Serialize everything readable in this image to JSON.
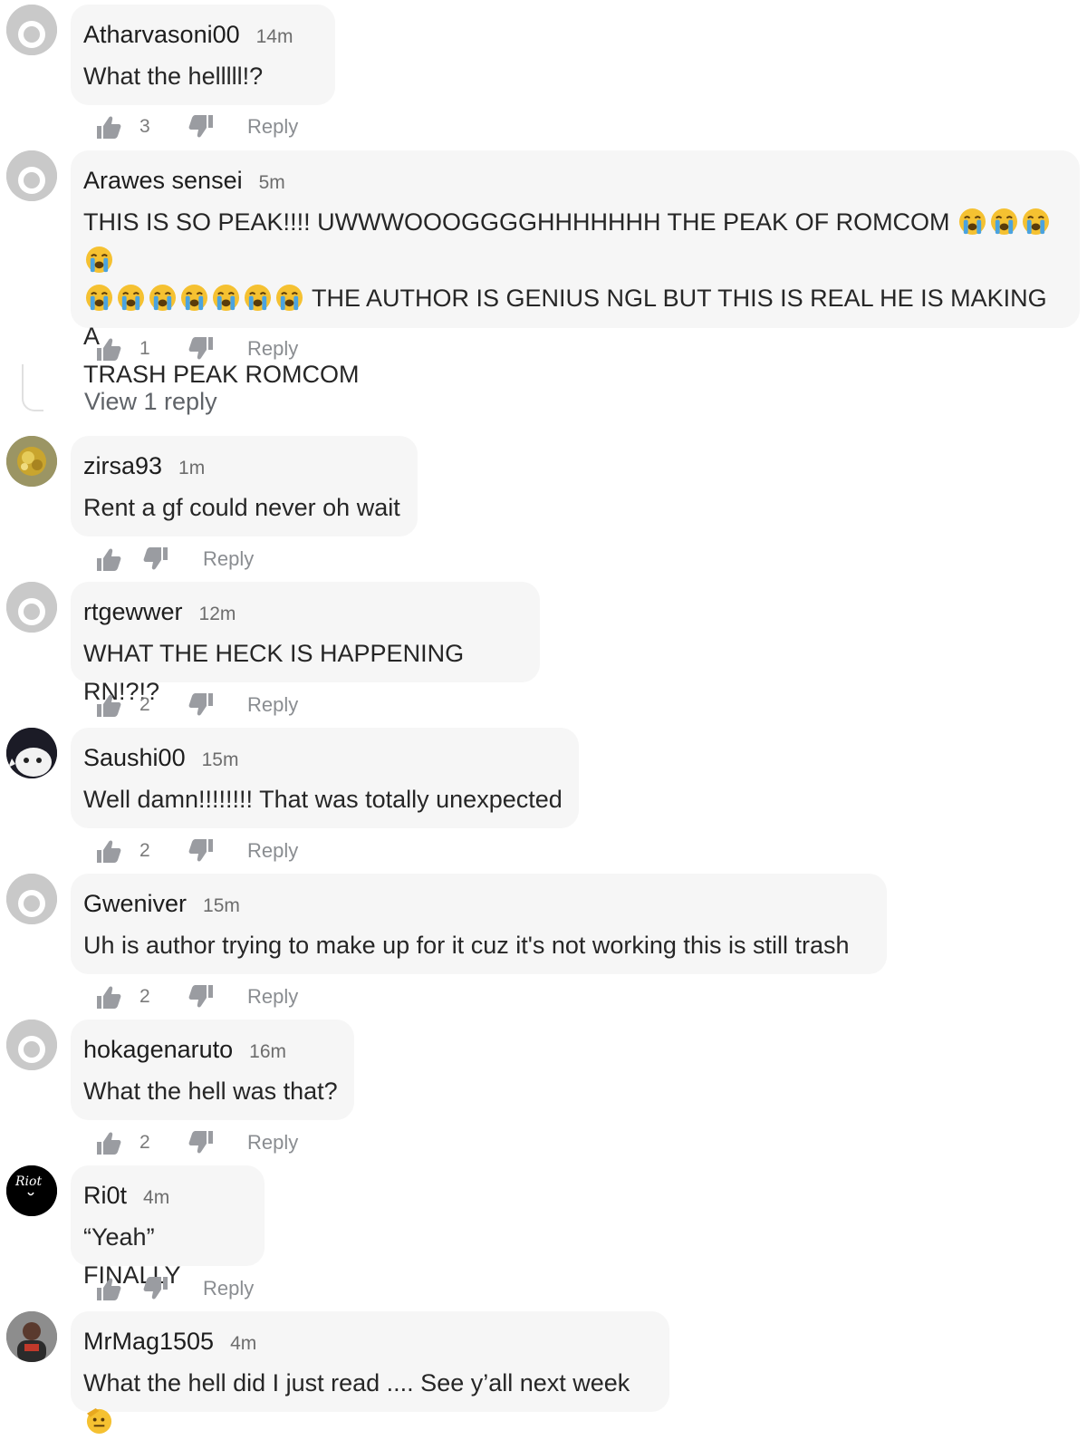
{
  "reply_label": "Reply",
  "comments": [
    {
      "username": "Atharvasoni00",
      "time": "14m",
      "text": "What the helllll!?",
      "likes": "3",
      "avatar": "default-avatar"
    },
    {
      "username": "Arawes sensei",
      "time": "5m",
      "text_line1": "THIS IS SO PEAK!!!! UWWWOOOGGGGHHHHHHH THE PEAK OF ROMCOM",
      "text_line2": "THE AUTHOR IS GENIUS NGL BUT THIS IS REAL HE IS MAKING A",
      "text_line3": "TRASH PEAK ROMCOM",
      "likes": "1",
      "avatar": "default-avatar",
      "view_replies": "View 1 reply",
      "emoji": "loudly-crying-face"
    },
    {
      "username": "zirsa93",
      "time": "1m",
      "text": "Rent a gf could never oh wait",
      "likes": "",
      "avatar": "gold-photo-avatar"
    },
    {
      "username": "rtgewwer",
      "time": "12m",
      "text": "WHAT THE HECK IS HAPPENING RN!?!?",
      "likes": "2",
      "avatar": "default-avatar"
    },
    {
      "username": "Saushi00",
      "time": "15m",
      "text": "Well damn!!!!!!!! That was totally unexpected",
      "likes": "2",
      "avatar": "anime-avatar"
    },
    {
      "username": "Gweniver",
      "time": "15m",
      "text": "Uh is author trying to make up for it cuz it's not working this is still trash",
      "likes": "2",
      "avatar": "default-avatar"
    },
    {
      "username": "hokagenaruto",
      "time": "16m",
      "text": "What the hell was that?",
      "likes": "2",
      "avatar": "default-avatar"
    },
    {
      "username": "Ri0t",
      "time": "4m",
      "text": "“Yeah” FINALLY",
      "likes": "",
      "avatar": "riot-logo-avatar",
      "avatar_text": "Riot"
    },
    {
      "username": "MrMag1505",
      "time": "4m",
      "text": "What the hell did I just read .... See y’all next week",
      "likes": "",
      "avatar": "photo-avatar",
      "emoji": "saluting-face"
    }
  ],
  "colors": {
    "bubble": "#f6f6f6",
    "icon": "#9a9ca1",
    "emoji": "#f5c131",
    "tear": "#4aa3df"
  }
}
